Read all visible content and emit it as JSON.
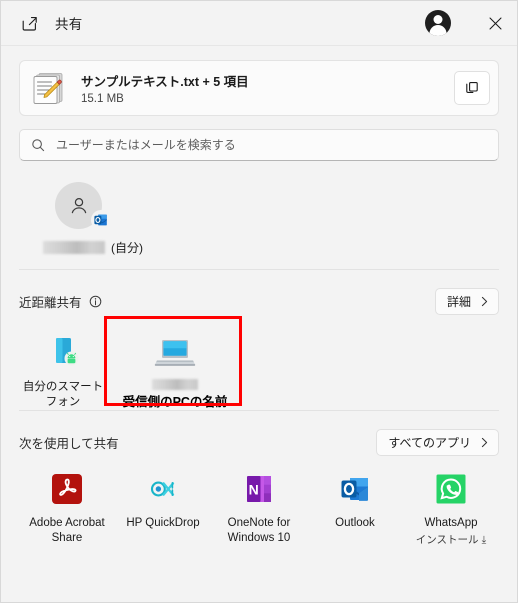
{
  "window": {
    "title": "共有",
    "share_icon": "share-icon",
    "account_avatar": "account-avatar-icon",
    "close_label": "×"
  },
  "file_card": {
    "icon": "text-file-stack-icon",
    "name": "サンプルテキスト.txt + 5 項目",
    "size": "15.1 MB",
    "copy_button": {
      "icon": "copy-icon",
      "label": ""
    }
  },
  "search": {
    "icon": "search-icon",
    "placeholder": "ユーザーまたはメールを検索する",
    "value": ""
  },
  "contacts": {
    "items": [
      {
        "avatar_icon": "person-icon",
        "badge_icon": "outlook-icon",
        "name_redacted": true,
        "suffix": "(自分)"
      }
    ]
  },
  "nearby_sharing": {
    "title": "近距離共有",
    "info_icon": "info-icon",
    "details_button": {
      "label": "詳細",
      "chevron": "chevron-right-icon"
    },
    "devices": [
      {
        "icon": "phone-icon",
        "badge_icon": "android-icon",
        "label": "自分のスマートフォン",
        "label_lines": [
          "自分のスマート",
          "フォン"
        ],
        "highlighted": false,
        "name_redacted": false,
        "annotation": ""
      },
      {
        "icon": "laptop-icon",
        "badge_icon": "",
        "label": "",
        "label_lines": [],
        "highlighted": true,
        "name_redacted": true,
        "annotation": "受信側のPCの名前"
      }
    ],
    "highlight_color": "#ff0000"
  },
  "share_with": {
    "title": "次を使用して共有",
    "all_apps_button": {
      "label": "すべてのアプリ",
      "chevron": "chevron-right-icon"
    },
    "apps": [
      {
        "icon": "adobe-acrobat-icon",
        "label": "Adobe Acrobat Share",
        "label_lines": [
          "Adobe Acrobat",
          "Share"
        ],
        "sub_label": "",
        "color": "#b3120d"
      },
      {
        "icon": "hp-quickdrop-icon",
        "label": "HP QuickDrop",
        "label_lines": [
          "HP QuickDrop"
        ],
        "sub_label": "",
        "color": "#2ec5c5"
      },
      {
        "icon": "onenote-icon",
        "label": "OneNote for Windows 10",
        "label_lines": [
          "OneNote for",
          "Windows 10"
        ],
        "sub_label": "",
        "color": "#7719aa"
      },
      {
        "icon": "outlook-icon",
        "label": "Outlook",
        "label_lines": [
          "Outlook"
        ],
        "sub_label": "",
        "color": "#0a5ca4"
      },
      {
        "icon": "whatsapp-icon",
        "label": "WhatsApp",
        "label_lines": [
          "WhatsApp"
        ],
        "sub_label": "インストール",
        "sub_glyph": "⤓",
        "color": "#25d366"
      }
    ]
  }
}
